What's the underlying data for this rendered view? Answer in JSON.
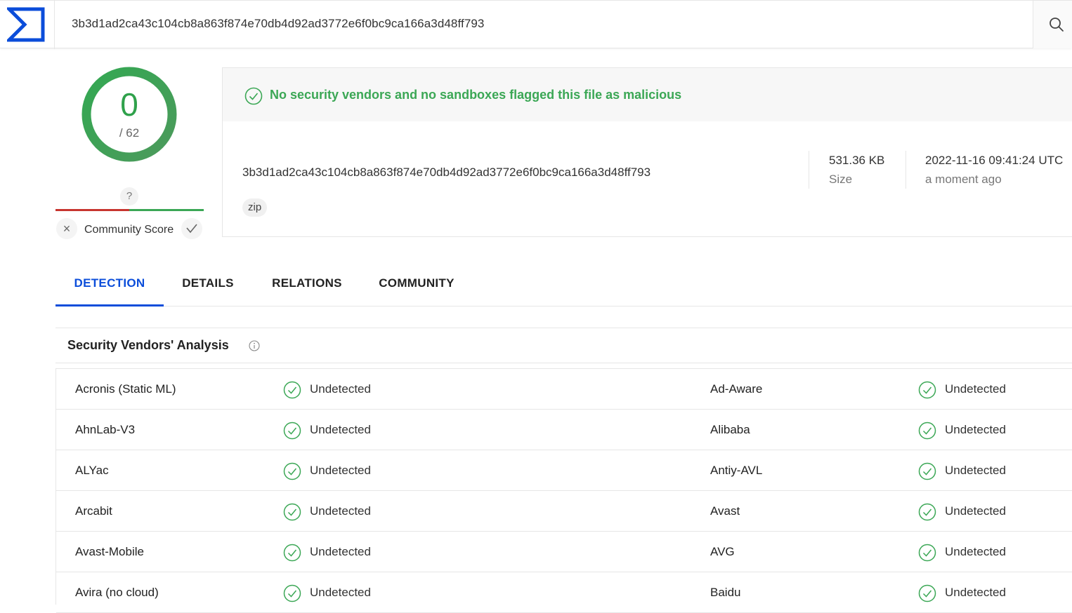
{
  "search": {
    "query": "3b3d1ad2ca43c104cb8a863f874e70db4d92ad3772e6f0bc9ca166a3d48ff793"
  },
  "score": {
    "detections": "0",
    "total": "/ 62"
  },
  "community": {
    "badge": "?",
    "label": "Community Score"
  },
  "summary": {
    "verdict": "No security vendors and no sandboxes flagged this file as malicious",
    "hash": "3b3d1ad2ca43c104cb8a863f874e70db4d92ad3772e6f0bc9ca166a3d48ff793",
    "tag": "zip",
    "size_value": "531.36 KB",
    "size_label": "Size",
    "date_value": "2022-11-16 09:41:24 UTC",
    "date_label": "a moment ago"
  },
  "tabs": [
    {
      "label": "DETECTION"
    },
    {
      "label": "DETAILS"
    },
    {
      "label": "RELATIONS"
    },
    {
      "label": "COMMUNITY"
    }
  ],
  "vendors_section": {
    "title": "Security Vendors' Analysis"
  },
  "vendors": [
    {
      "left": "Acronis (Static ML)",
      "left_status": "Undetected",
      "right": "Ad-Aware",
      "right_status": "Undetected"
    },
    {
      "left": "AhnLab-V3",
      "left_status": "Undetected",
      "right": "Alibaba",
      "right_status": "Undetected"
    },
    {
      "left": "ALYac",
      "left_status": "Undetected",
      "right": "Antiy-AVL",
      "right_status": "Undetected"
    },
    {
      "left": "Arcabit",
      "left_status": "Undetected",
      "right": "Avast",
      "right_status": "Undetected"
    },
    {
      "left": "Avast-Mobile",
      "left_status": "Undetected",
      "right": "AVG",
      "right_status": "Undetected"
    },
    {
      "left": "Avira (no cloud)",
      "left_status": "Undetected",
      "right": "Baidu",
      "right_status": "Undetected"
    }
  ],
  "colors": {
    "brand": "#0b4dda",
    "clean": "#3ba755",
    "malicious": "#c7352f"
  }
}
